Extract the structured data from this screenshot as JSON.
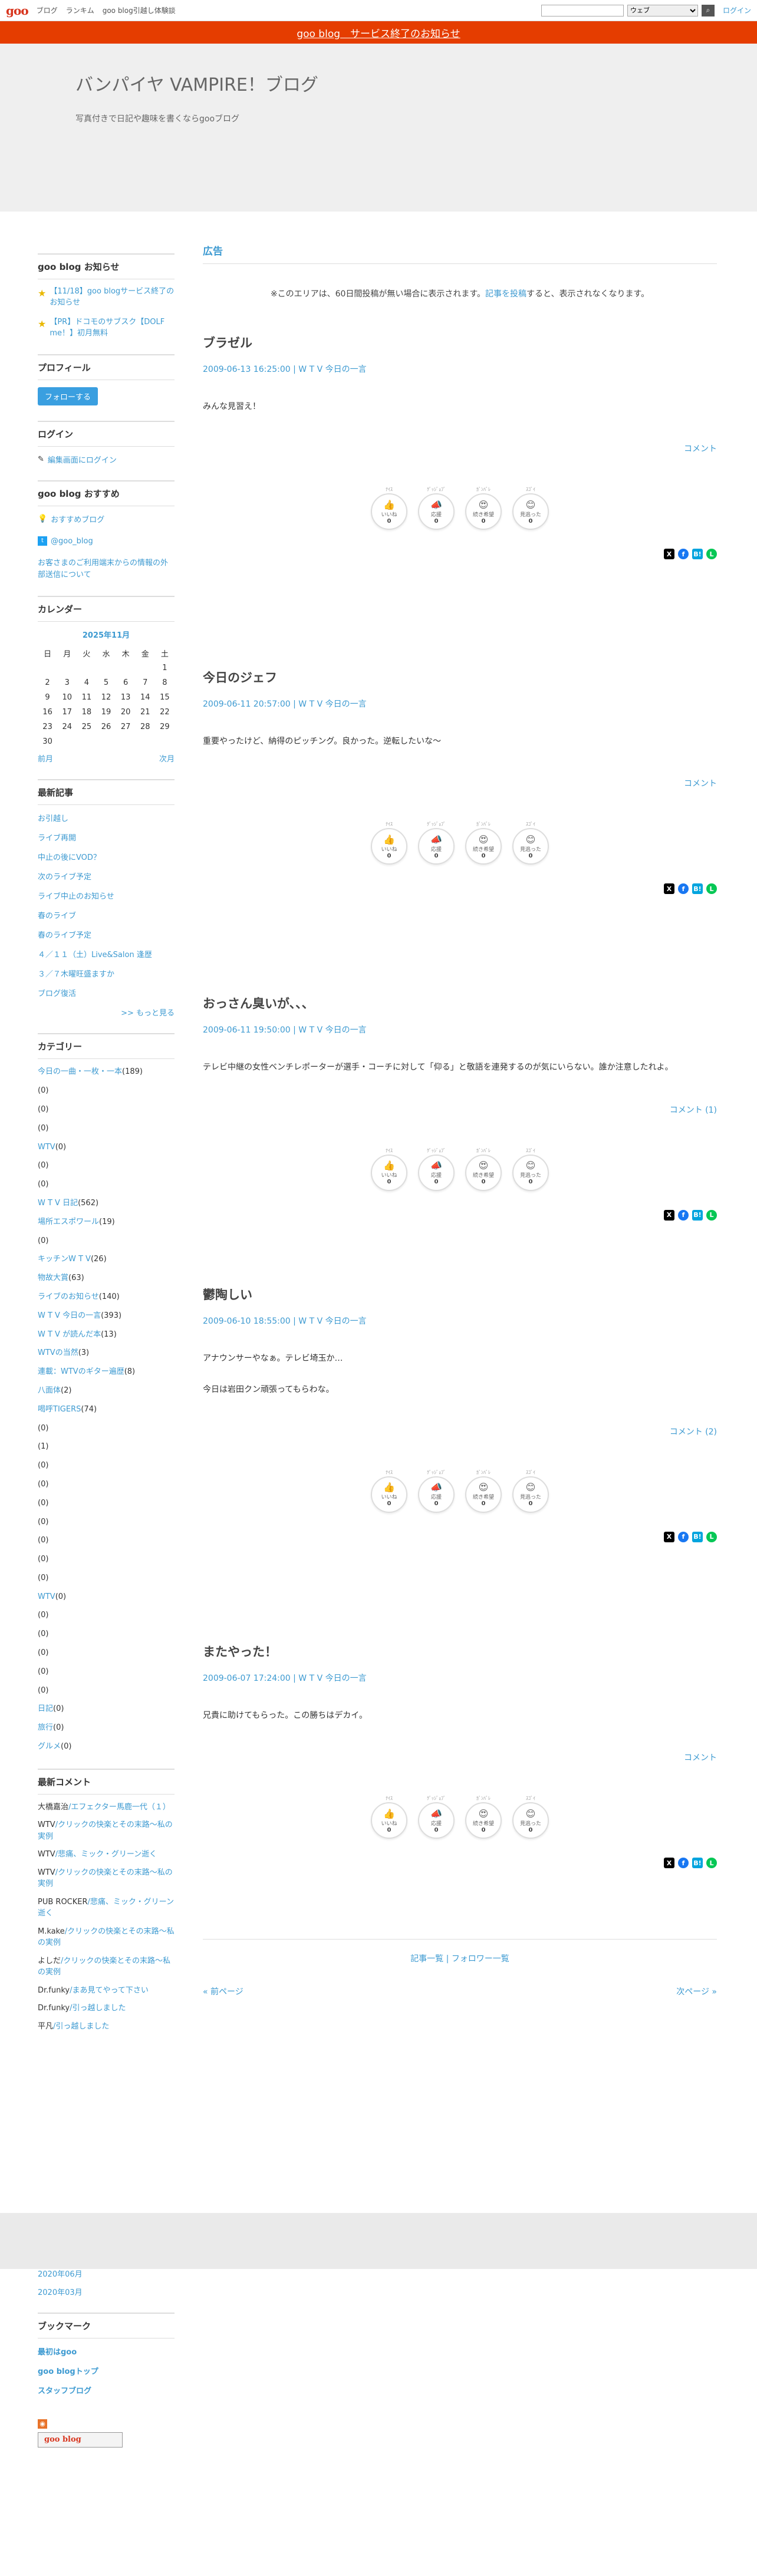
{
  "gbar": {
    "logo": "goo",
    "nav": [
      "ブログ",
      "ランキム",
      "goo blog引越し体験談"
    ],
    "search_placeholder": "",
    "search_scope": "ウェブ",
    "search_icon": "search-icon",
    "login": "ログイン"
  },
  "notice_bar": "goo blog　サービス終了のお知らせ",
  "header": {
    "title": "バンパイヤ VAMPIRE！ブログ",
    "desc": "写真付きで日記や趣味を書くならgooブログ"
  },
  "sidebar": {
    "notice": {
      "heading": "goo blog お知らせ",
      "items": [
        "【11/18】goo blogサービス終了のお知らせ",
        "【PR】ドコモのサブスク【DOLF me！】初月無料"
      ]
    },
    "profile": {
      "heading": "プロフィール",
      "follow": "フォローする"
    },
    "login": {
      "heading": "ログイン",
      "link": "編集画面にログイン"
    },
    "recommend": {
      "heading": "goo blog おすすめ",
      "items": [
        "おすすめブログ",
        "@goo_blog",
        "お客さまのご利用端末からの情報の外部送信について"
      ]
    },
    "calendar": {
      "heading": "カレンダー",
      "month": "2025年11月",
      "weekdays": [
        "日",
        "月",
        "火",
        "水",
        "木",
        "金",
        "土"
      ],
      "rows": [
        [
          "",
          "",
          "",
          "",
          "",
          "",
          "1"
        ],
        [
          "2",
          "3",
          "4",
          "5",
          "6",
          "7",
          "8"
        ],
        [
          "9",
          "10",
          "11",
          "12",
          "13",
          "14",
          "15"
        ],
        [
          "16",
          "17",
          "18",
          "19",
          "20",
          "21",
          "22"
        ],
        [
          "23",
          "24",
          "25",
          "26",
          "27",
          "28",
          "29"
        ],
        [
          "30",
          "",
          "",
          "",
          "",
          "",
          ""
        ]
      ],
      "prev": "前月",
      "next": "次月"
    },
    "recent": {
      "heading": "最新記事",
      "items": [
        "お引越し",
        "ライブ再開",
        "中止の後にVOD？",
        "次のライブ予定",
        "ライブ中止のお知らせ",
        "春のライブ",
        "春のライブ予定",
        "４／１１（土）Live&Salon 逢歴",
        "３／７木曜旺盛ますか",
        "ブログ復活"
      ],
      "more": ">> もっと見る"
    },
    "category": {
      "heading": "カテゴリー",
      "items": [
        {
          "name": "今日の一曲・一枚・一本",
          "count": "(189)"
        },
        {
          "name": "",
          "count": "(0)"
        },
        {
          "name": "",
          "count": "(0)"
        },
        {
          "name": "",
          "count": "(0)"
        },
        {
          "name": "WTV",
          "count": "(0)"
        },
        {
          "name": "",
          "count": "(0)"
        },
        {
          "name": "",
          "count": "(0)"
        },
        {
          "name": "W T V 日記",
          "count": "(562)"
        },
        {
          "name": "場所エスポワール",
          "count": "(19)"
        },
        {
          "name": "",
          "count": "(0)"
        },
        {
          "name": "キッチンW T V",
          "count": "(26)"
        },
        {
          "name": "物故大賞",
          "count": "(63)"
        },
        {
          "name": "ライブのお知らせ",
          "count": "(140)"
        },
        {
          "name": "W T V 今日の一言",
          "count": "(393)"
        },
        {
          "name": "W T V が読んだ本",
          "count": "(13)"
        },
        {
          "name": "WTVの当然",
          "count": "(3)"
        },
        {
          "name": "連載：WTVのギター遍歴",
          "count": "(8)"
        },
        {
          "name": "八面体",
          "count": "(2)"
        },
        {
          "name": "喝呼TIGERS",
          "count": "(74)"
        },
        {
          "name": "",
          "count": "(0)"
        },
        {
          "name": "",
          "count": "(1)"
        },
        {
          "name": "",
          "count": "(0)"
        },
        {
          "name": "",
          "count": "(0)"
        },
        {
          "name": "",
          "count": "(0)"
        },
        {
          "name": "",
          "count": "(0)"
        },
        {
          "name": "",
          "count": "(0)"
        },
        {
          "name": "",
          "count": "(0)"
        },
        {
          "name": "",
          "count": "(0)"
        },
        {
          "name": "WTV",
          "count": "(0)"
        },
        {
          "name": "",
          "count": "(0)"
        },
        {
          "name": "",
          "count": "(0)"
        },
        {
          "name": "",
          "count": "(0)"
        },
        {
          "name": "",
          "count": "(0)"
        },
        {
          "name": "",
          "count": "(0)"
        },
        {
          "name": "日記",
          "count": "(0)"
        },
        {
          "name": "旅行",
          "count": "(0)"
        },
        {
          "name": "グルメ",
          "count": "(0)"
        }
      ]
    },
    "comments": {
      "heading": "最新コメント",
      "items": [
        {
          "user": "大橋嘉治",
          "entry": "/エフェクター馬鹿一代（１）"
        },
        {
          "user": "WTV",
          "entry": "/クリックの快楽とその末路～私の実例"
        },
        {
          "user": "WTV",
          "entry": "/悲痛、ミック・グリーン逝く"
        },
        {
          "user": "WTV",
          "entry": "/クリックの快楽とその末路～私の実例"
        },
        {
          "user": "PUB ROCKER",
          "entry": "/悲痛、ミック・グリーン逝く"
        },
        {
          "user": "M.kake",
          "entry": "/クリックの快楽とその末路～私の実例"
        },
        {
          "user": "よしだ",
          "entry": "/クリックの快楽とその末路～私の実例"
        },
        {
          "user": "Dr.funky",
          "entry": "/まあ見てやって下さい"
        },
        {
          "user": "Dr.funky",
          "entry": "/引っ越しました"
        },
        {
          "user": "平凡",
          "entry": "/引っ越しました"
        }
      ]
    }
  },
  "sidebar2": {
    "archives": [
      "2020年06月",
      "2020年03月"
    ],
    "bookmark": {
      "heading": "ブックマーク",
      "items": [
        "最初はgoo",
        "goo blogトップ",
        "スタッフブログ"
      ]
    },
    "rss_icon": "rss-icon",
    "badge": "goo blog"
  },
  "main": {
    "ad_heading": "広告",
    "ad_note": {
      "before": "※このエリアは、60日間投稿が無い場合に表示されます。",
      "link": "記事を投稿",
      "after": "すると、表示されなくなります。"
    },
    "reaction_caps": [
      "ﾅｲｽ",
      "ｸﾞｯｼﾞｮﾌﾞ",
      "ｶﾞﾝﾊﾞﾚ",
      "ｽｺﾞｲ"
    ],
    "reaction_labels": [
      "いいね",
      "応援",
      "続き希望",
      "見逃った"
    ],
    "reaction_icons": [
      "👍",
      "📣",
      "😍",
      "😊"
    ],
    "reaction_count": "0",
    "entries": [
      {
        "title": "ブラゼル",
        "meta": "2009-06-13 16:25:00 | W T V 今日の一言",
        "body": [
          "みんな見習え！"
        ],
        "comment": "コメント"
      },
      {
        "title": "今日のジェフ",
        "meta": "2009-06-11 20:57:00 | W T V 今日の一言",
        "body": [
          "重要やったけど、納得のピッチング。良かった。逆転したいな～"
        ],
        "comment": "コメント"
      },
      {
        "title": "おっさん臭いが、、、",
        "meta": "2009-06-11 19:50:00 | W T V 今日の一言",
        "body": [
          "テレビ中継の女性ベンチレポーターが選手・コーチに対して「仰る」と敬語を連発するのが気にいらない。誰か注意したれよ。"
        ],
        "comment": "コメント (1)"
      },
      {
        "title": "鬱陶しい",
        "meta": "2009-06-10 18:55:00 | W T V 今日の一言",
        "body": [
          "アナウンサーやなぁ。テレビ埼玉か…",
          "今日は岩田クン頑張ってもらわな。"
        ],
        "comment": "コメント (2)"
      },
      {
        "title": "またやった！",
        "meta": "2009-06-07 17:24:00 | W T V 今日の一言",
        "body": [
          "兄貴に助けてもらった。この勝ちはデカイ。"
        ],
        "comment": "コメント"
      }
    ],
    "pager": {
      "list": "記事一覧",
      "sep": " | ",
      "follower": "フォロワー一覧",
      "prev": "« 前ページ",
      "next": "次ページ »"
    },
    "share_labels": [
      "X",
      "f",
      "B!",
      "L"
    ]
  }
}
